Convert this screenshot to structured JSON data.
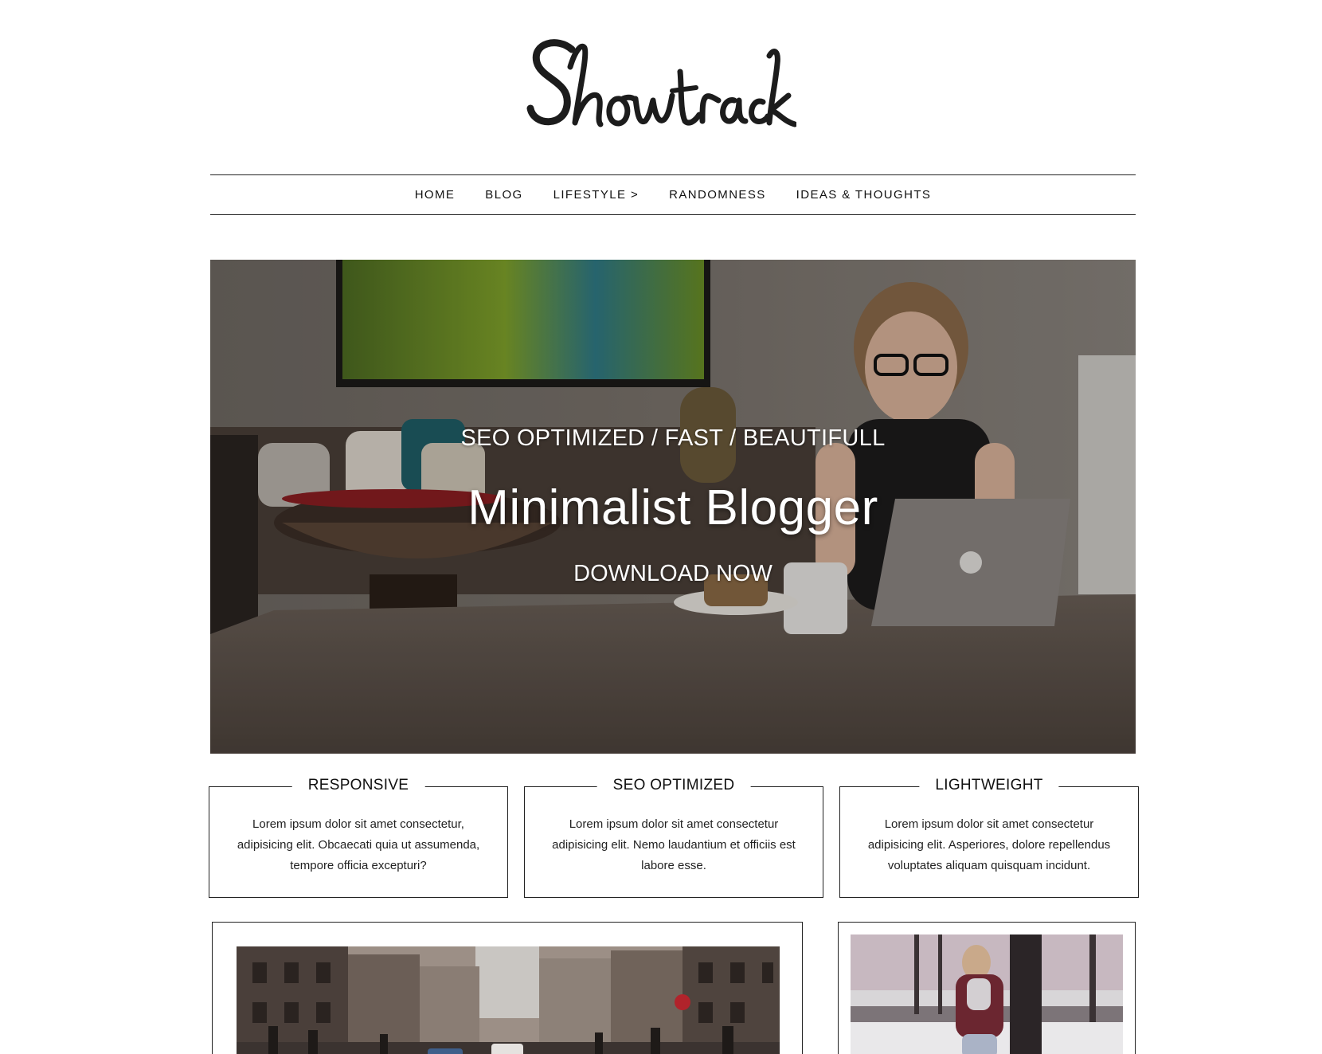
{
  "site": {
    "logo_text": "Showtrack"
  },
  "nav": {
    "items": [
      {
        "label": "HOME"
      },
      {
        "label": "BLOG"
      },
      {
        "label": "LIFESTYLE >"
      },
      {
        "label": "RANDOMNESS"
      },
      {
        "label": "IDEAS & THOUGHTS"
      }
    ]
  },
  "hero": {
    "subtitle": "SEO OPTIMIZED / FAST / BEAUTIFULL",
    "title": "Minimalist Blogger",
    "cta": "DOWNLOAD NOW"
  },
  "features": [
    {
      "title": "RESPONSIVE",
      "text": "Lorem ipsum dolor sit amet consectetur, adipisicing elit. Obcaecati quia ut assumenda, tempore officia excepturi?"
    },
    {
      "title": "SEO OPTIMIZED",
      "text": "Lorem ipsum dolor sit amet consectetur adipisicing elit. Nemo laudantium et officiis est labore esse."
    },
    {
      "title": "LIGHTWEIGHT",
      "text": "Lorem ipsum dolor sit amet consectetur adipisicing elit. Asperiores, dolore repellendus voluptates aliquam quisquam incidunt."
    }
  ],
  "posts": [
    {
      "image": "city-street-photo"
    },
    {
      "image": "woman-in-snow-photo"
    }
  ],
  "colors": {
    "text": "#111111",
    "border": "#222222",
    "background": "#ffffff",
    "hero_overlay_text": "#ffffff"
  }
}
